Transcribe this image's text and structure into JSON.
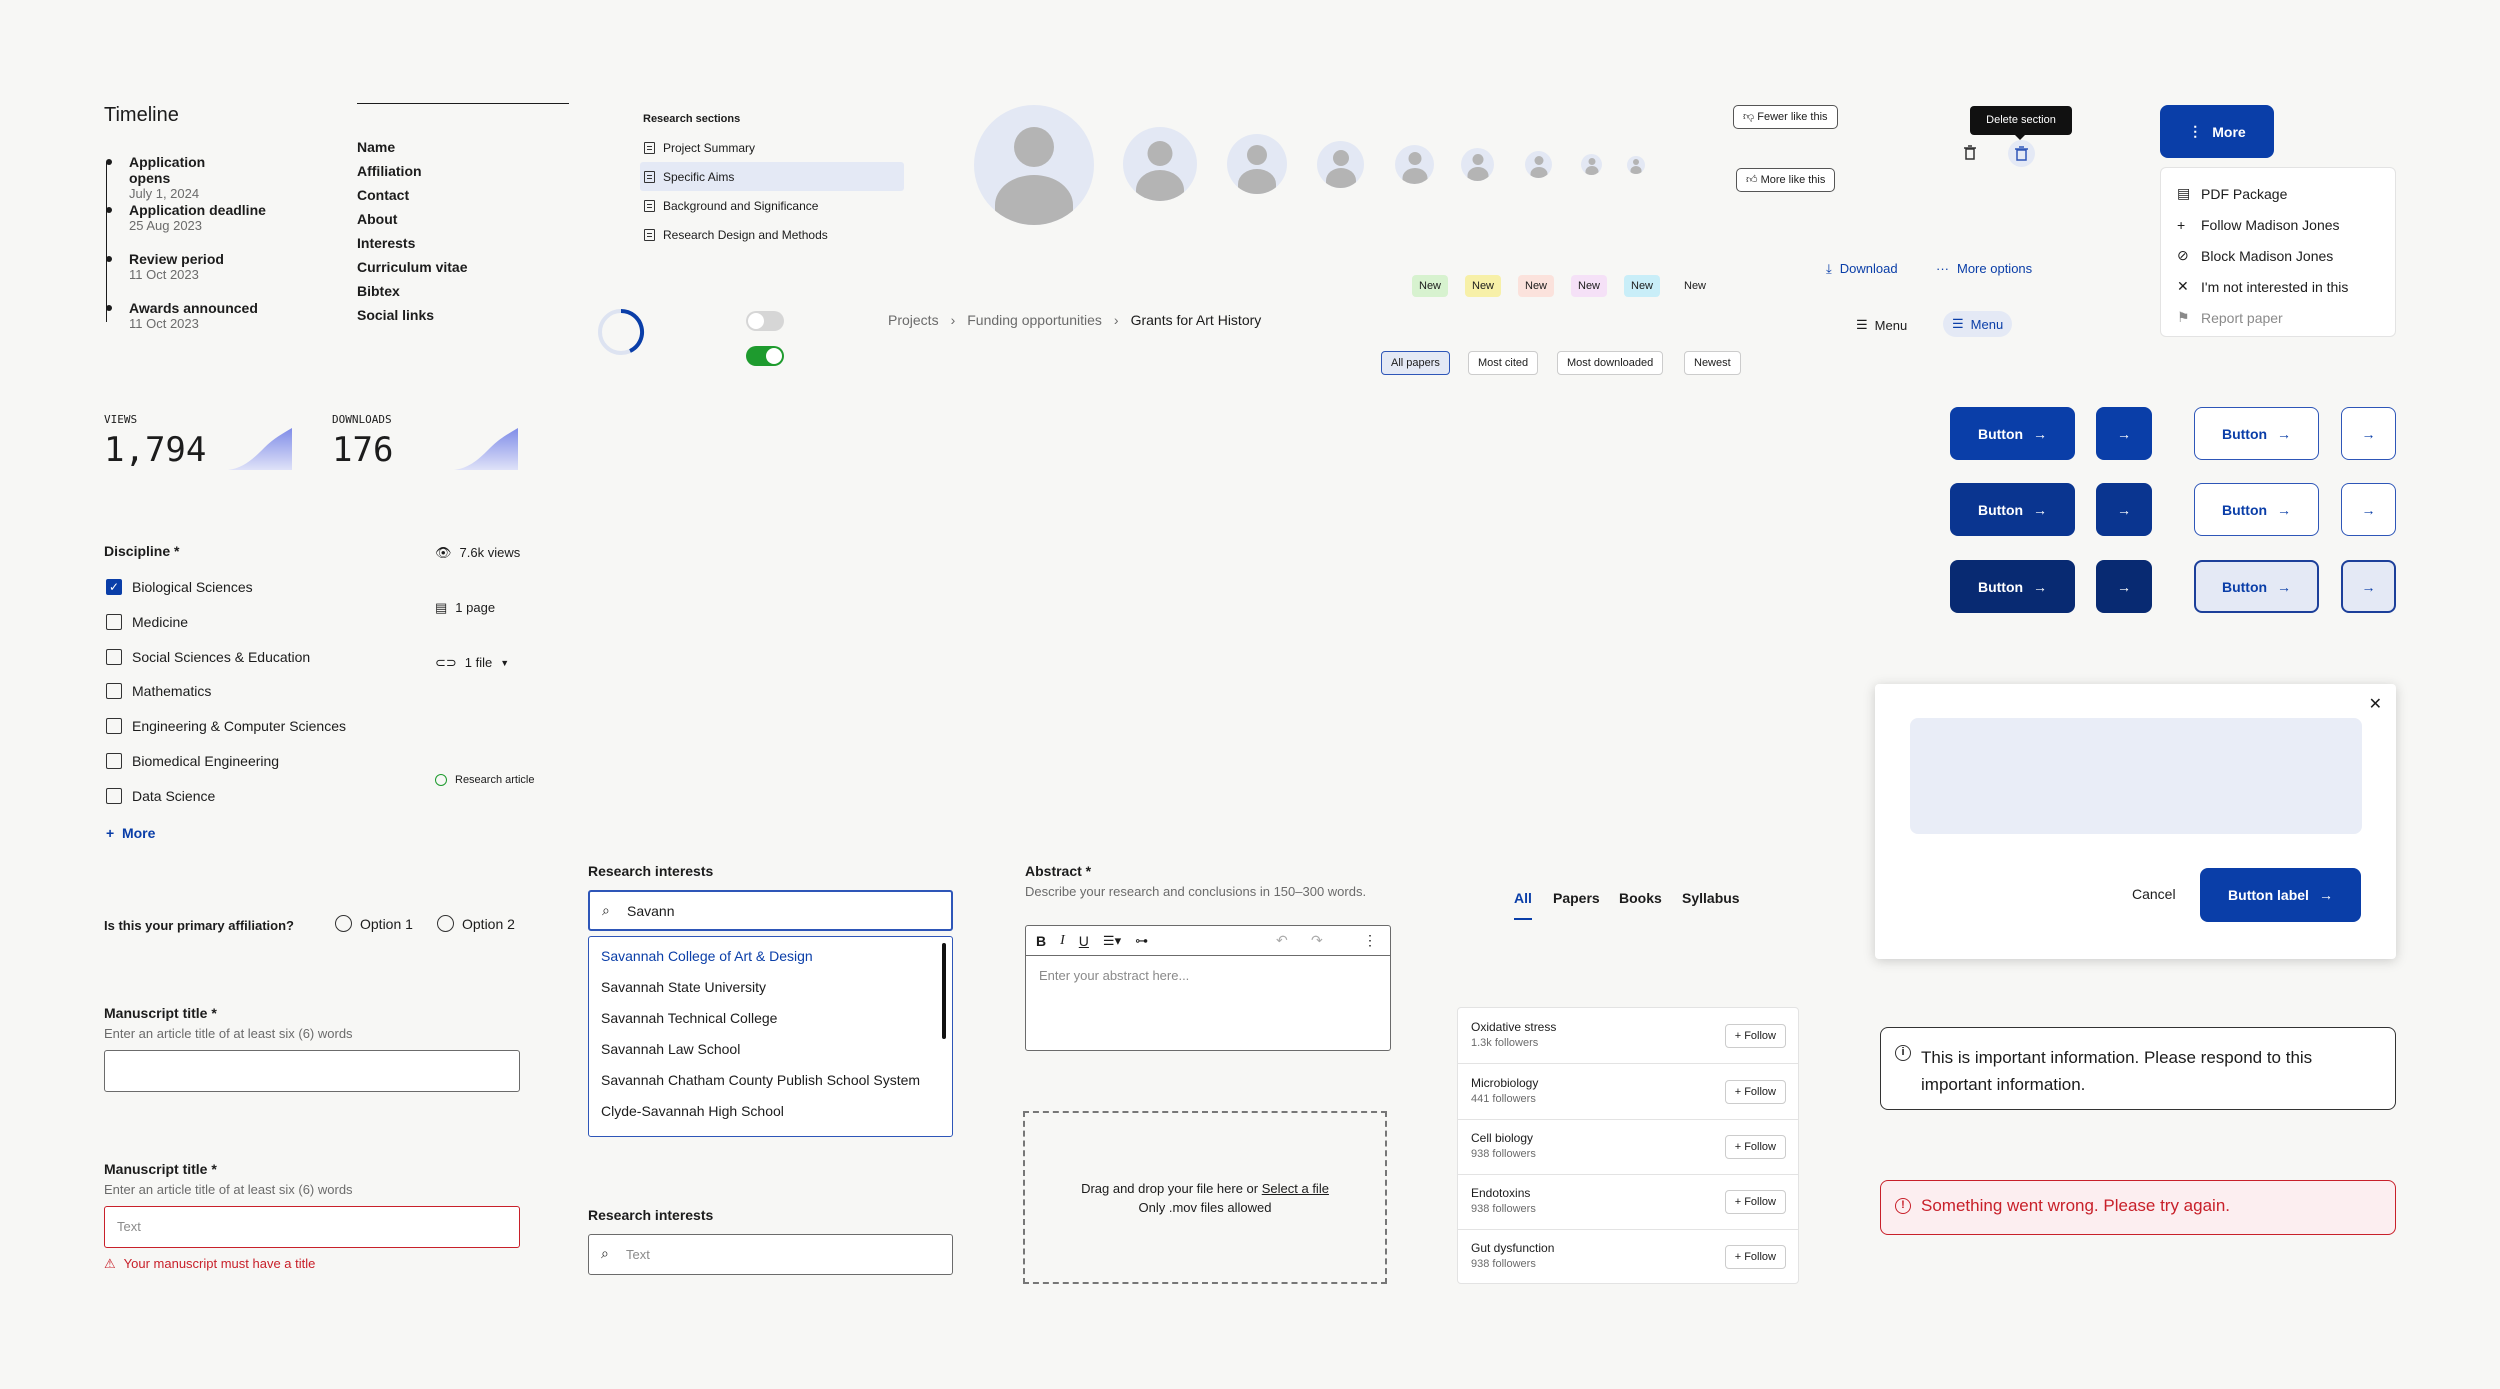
{
  "timeline": {
    "title": "Timeline",
    "items": [
      {
        "label": "Application opens",
        "date": "July 1, 2024"
      },
      {
        "label": "Application deadline",
        "date": "25 Aug 2023"
      },
      {
        "label": "Review period",
        "date": "11 Oct 2023"
      },
      {
        "label": "Awards announced",
        "date": "11 Oct 2023"
      }
    ]
  },
  "nav_list": [
    "Name",
    "Affiliation",
    "Contact",
    "About",
    "Interests",
    "Curriculum vitae",
    "Bibtex",
    "Social links"
  ],
  "research_sections": {
    "title": "Research sections",
    "items": [
      "Project Summary",
      "Specific Aims",
      "Background and Significance",
      "Research Design and Methods"
    ]
  },
  "feedback": {
    "fewer": "Fewer like this",
    "more": "More like this"
  },
  "tooltip": {
    "delete": "Delete section"
  },
  "more_menu": {
    "button": "More",
    "items": [
      "PDF Package",
      "Follow Madison Jones",
      "Block Madison Jones",
      "I'm not interested in this",
      "Report paper"
    ]
  },
  "badges": [
    "New",
    "New",
    "New",
    "New",
    "New",
    "New"
  ],
  "actions": {
    "download": "Download",
    "more_options": "More options",
    "menu1": "Menu",
    "menu2": "Menu"
  },
  "breadcrumb": [
    "Projects",
    "Funding opportunities",
    "Grants for Art History"
  ],
  "filters": [
    "All papers",
    "Most cited",
    "Most downloaded",
    "Newest"
  ],
  "stats": {
    "views_label": "VIEWS",
    "views": "1,794",
    "downloads_label": "DOWNLOADS",
    "downloads": "176"
  },
  "buttons": {
    "label": "Button"
  },
  "discipline": {
    "label": "Discipline *",
    "options": [
      {
        "label": "Biological Sciences",
        "checked": true
      },
      {
        "label": "Medicine",
        "checked": false
      },
      {
        "label": "Social Sciences & Education",
        "checked": false
      },
      {
        "label": "Mathematics",
        "checked": false
      },
      {
        "label": "Engineering & Computer Sciences",
        "checked": false
      },
      {
        "label": "Biomedical Engineering",
        "checked": false
      },
      {
        "label": "Data Science",
        "checked": false
      }
    ],
    "more": "More"
  },
  "meta": {
    "views": "7.6k views",
    "pages": "1 page",
    "files": "1 file",
    "type": "Research article"
  },
  "affiliation": {
    "question": "Is this your primary affiliation?",
    "option1": "Option 1",
    "option2": "Option 2"
  },
  "manuscript1": {
    "label": "Manuscript title *",
    "hint": "Enter an article title of at least six (6) words"
  },
  "manuscript2": {
    "label": "Manuscript title *",
    "hint": "Enter an article title of at least six (6) words",
    "placeholder": "Text",
    "error": "Your manuscript must have a title"
  },
  "interests1": {
    "label": "Research interests",
    "value": "Savann",
    "options": [
      "Savannah College of Art & Design",
      "Savannah State University",
      "Savannah Technical College",
      "Savannah Law School",
      "Savannah Chatham County Publish School System",
      "Clyde-Savannah High School"
    ]
  },
  "interests2": {
    "label": "Research interests",
    "placeholder": "Text"
  },
  "abstract": {
    "label": "Abstract *",
    "hint": "Describe your research and conclusions in 150–300 words.",
    "placeholder": "Enter your abstract here..."
  },
  "upload": {
    "text": "Drag and drop your file here or",
    "link": "Select a file",
    "note": "Only .mov files allowed"
  },
  "tabs": [
    "All",
    "Papers",
    "Books",
    "Syllabus"
  ],
  "topics": [
    {
      "name": "Oxidative stress",
      "followers": "1.3k followers"
    },
    {
      "name": "Microbiology",
      "followers": "441 followers"
    },
    {
      "name": "Cell biology",
      "followers": "938 followers"
    },
    {
      "name": "Endotoxins",
      "followers": "938 followers"
    },
    {
      "name": "Gut dysfunction",
      "followers": "938 followers"
    }
  ],
  "follow_label": "Follow",
  "dialog": {
    "cancel": "Cancel",
    "primary": "Button label"
  },
  "info": {
    "text": "This is important information. Please respond to this important information."
  },
  "error_alert": {
    "text": "Something went wrong. Please try again."
  },
  "colors": {
    "primary": "#0a3ea8",
    "primary_dark": "#0a2f86",
    "error": "#c8202a",
    "success": "#1e9b2e"
  }
}
